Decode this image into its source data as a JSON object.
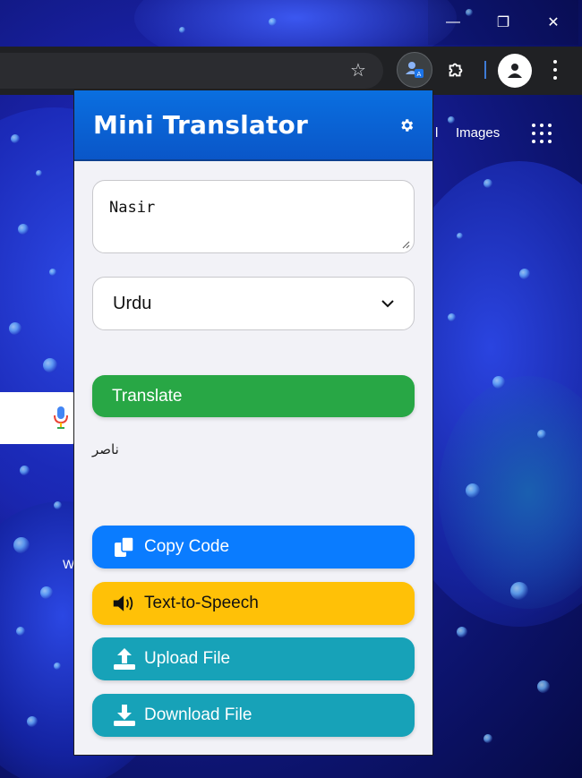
{
  "window": {
    "minimize_glyph": "—",
    "maximize_glyph": "❐",
    "close_glyph": "✕"
  },
  "toolbar": {
    "star_glyph": "☆"
  },
  "background_page": {
    "link_fragment": "l",
    "images_link": "Images",
    "partial_text": "W"
  },
  "popup": {
    "title": "Mini Translator",
    "input_text": "Nasir",
    "language_selected": "Urdu",
    "translate_label": "Translate",
    "result_text": "ناصر",
    "buttons": {
      "copy": "Copy Code",
      "tts": "Text-to-Speech",
      "upload": "Upload File",
      "download": "Download File"
    }
  },
  "colors": {
    "header": "#0a6fe0",
    "translate": "#28a745",
    "copy": "#0a7cff",
    "tts": "#ffc107",
    "file": "#17a2b8"
  },
  "icons": [
    "minimize-icon",
    "maximize-icon",
    "close-icon",
    "star-icon",
    "translate-extension-icon",
    "puzzle-icon",
    "profile-icon",
    "kebab-menu-icon",
    "apps-grid-icon",
    "mic-icon",
    "gear-icon",
    "copy-icon",
    "speaker-icon",
    "upload-icon",
    "download-icon"
  ]
}
